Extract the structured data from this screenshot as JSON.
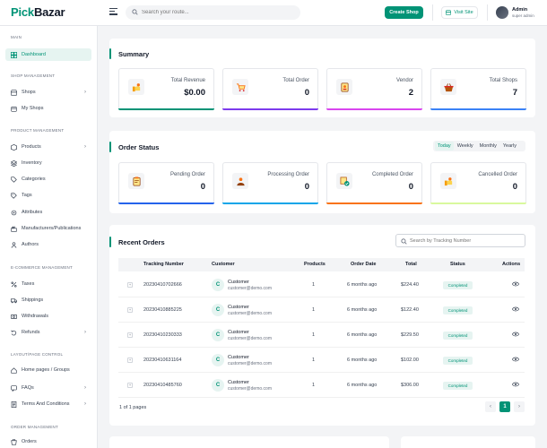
{
  "header": {
    "logo_part1": "Pick",
    "logo_part2": "Bazar",
    "search_placeholder": "Search your route...",
    "create_shop": "Create Shop",
    "visit_site": "Visit Site",
    "user_name": "Admin",
    "user_role": "super admin"
  },
  "sidebar": {
    "main_head": "MAIN",
    "dashboard": "Dashboard",
    "shop_head": "SHOP MANAGEMENT",
    "shops": "Shops",
    "my_shops": "My Shops",
    "product_head": "PRODUCT MANAGEMENT",
    "products": "Products",
    "inventory": "Inventory",
    "categories": "Categories",
    "tags": "Tags",
    "attributes": "Attributes",
    "manufacturers": "Manufacturers/Publications",
    "authors": "Authors",
    "ecom_head": "E-COMMERCE MANAGEMENT",
    "taxes": "Taxes",
    "shippings": "Shippings",
    "withdrawals": "Withdrawals",
    "refunds": "Refunds",
    "layout_head": "LAYOUT/PAGE CONTROL",
    "home_pages": "Home pages / Groups",
    "faqs": "FAQs",
    "terms": "Terms And Conditions",
    "order_head": "ORDER MANAGEMENT",
    "orders": "Orders"
  },
  "summary": {
    "title": "Summary",
    "stats": [
      {
        "label": "Total Revenue",
        "value": "$0.00",
        "color": "#019376"
      },
      {
        "label": "Total Order",
        "value": "0",
        "color": "#7c3aed"
      },
      {
        "label": "Vendor",
        "value": "2",
        "color": "#d946ef"
      },
      {
        "label": "Total Shops",
        "value": "7",
        "color": "#3b82f6"
      }
    ]
  },
  "order_status": {
    "title": "Order Status",
    "periods": [
      "Today",
      "Weekly",
      "Monthly",
      "Yearly"
    ],
    "stats": [
      {
        "label": "Pending Order",
        "value": "0",
        "color": "#2563eb"
      },
      {
        "label": "Processing Order",
        "value": "0",
        "color": "#0ea5e9"
      },
      {
        "label": "Completed Order",
        "value": "0",
        "color": "#f97316"
      },
      {
        "label": "Cancelled Order",
        "value": "0",
        "color": "#d9f99d"
      }
    ]
  },
  "recent_orders": {
    "title": "Recent Orders",
    "search_placeholder": "Search by Tracking Number",
    "columns": [
      "Tracking Number",
      "Customer",
      "Products",
      "Order Date",
      "Total",
      "Status",
      "Actions"
    ],
    "rows": [
      {
        "tracking": "20230410702666",
        "initial": "C",
        "customer": "Customer",
        "email": "customer@demo.com",
        "products": "1",
        "date": "6 months ago",
        "total": "$224.40",
        "status": "Completed"
      },
      {
        "tracking": "20230410885225",
        "initial": "C",
        "customer": "Customer",
        "email": "customer@demo.com",
        "products": "1",
        "date": "6 months ago",
        "total": "$122.40",
        "status": "Completed"
      },
      {
        "tracking": "20230410230333",
        "initial": "C",
        "customer": "Customer",
        "email": "customer@demo.com",
        "products": "1",
        "date": "6 months ago",
        "total": "$229.50",
        "status": "Completed"
      },
      {
        "tracking": "20230410631164",
        "initial": "C",
        "customer": "Customer",
        "email": "customer@demo.com",
        "products": "1",
        "date": "6 months ago",
        "total": "$102.00",
        "status": "Completed"
      },
      {
        "tracking": "20230410485760",
        "initial": "C",
        "customer": "Customer",
        "email": "customer@demo.com",
        "products": "1",
        "date": "6 months ago",
        "total": "$306.00",
        "status": "Completed"
      }
    ],
    "pager_text": "1 of 1 pages",
    "current_page": "1",
    "prev": "‹",
    "next": "›"
  }
}
